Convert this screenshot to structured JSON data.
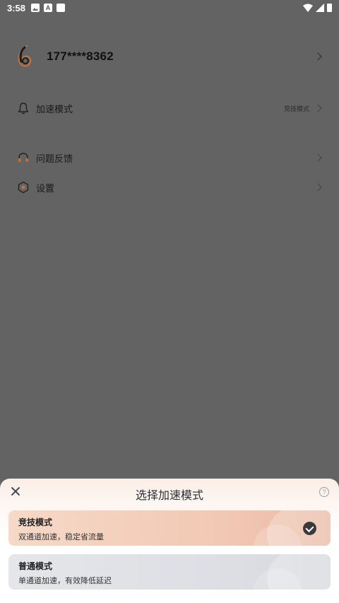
{
  "status_bar": {
    "time": "3:58"
  },
  "profile": {
    "phone": "177****8362"
  },
  "menu": {
    "accel_mode": {
      "label": "加速模式",
      "value": "竞技模式"
    },
    "feedback": {
      "label": "问题反馈"
    },
    "settings": {
      "label": "设置"
    }
  },
  "sheet": {
    "title": "选择加速模式",
    "help": "?",
    "modes": [
      {
        "name": "竞技模式",
        "desc": "双通道加速，稳定省流量",
        "selected": true
      },
      {
        "name": "普通模式",
        "desc": "单通道加速，有效降低延迟",
        "selected": false
      }
    ]
  },
  "colors": {
    "overlay": "#636363",
    "selected_card": "#f1c7b2",
    "normal_card": "#dcdee3",
    "logo_accent": "#c1713c"
  }
}
